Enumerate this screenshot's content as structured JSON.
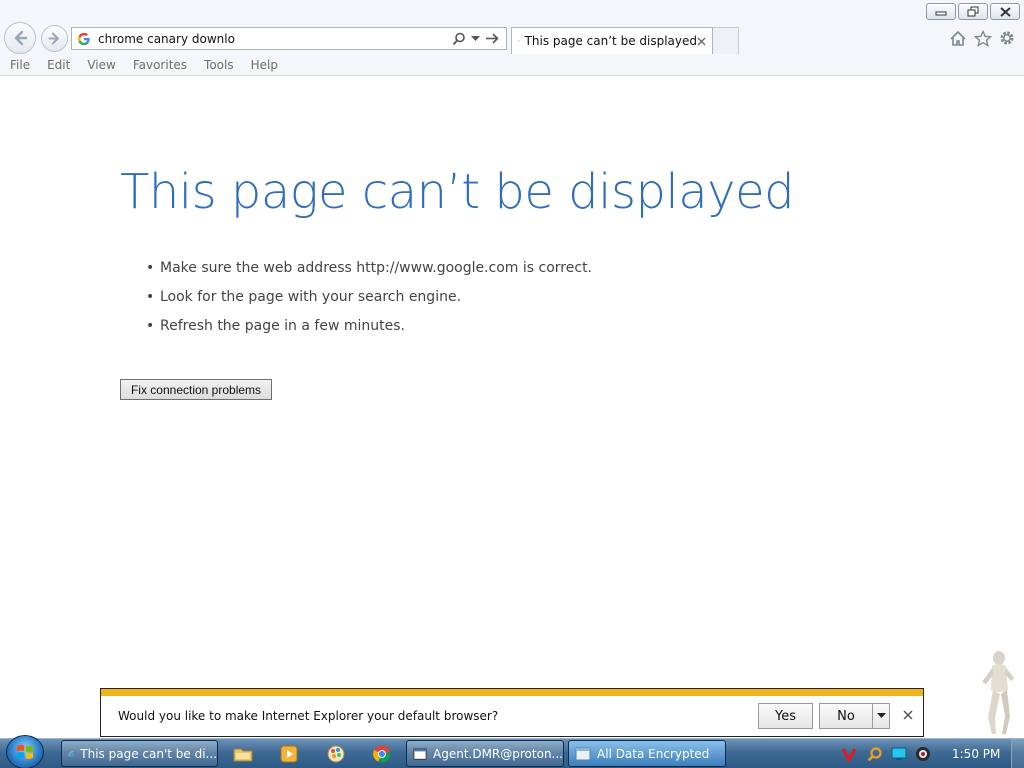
{
  "browser": {
    "address": {
      "text": "chrome canary downlo",
      "icon": "google-g-icon"
    },
    "tab": {
      "title": "This page can’t be displayed",
      "icon": "google-g-icon"
    },
    "window_controls": [
      "minimize",
      "restore",
      "close"
    ],
    "toolbar_icons": [
      "home-icon",
      "favorites-star-icon",
      "tools-gear-icon"
    ]
  },
  "menu": {
    "items": [
      "File",
      "Edit",
      "View",
      "Favorites",
      "Tools",
      "Help"
    ]
  },
  "error_page": {
    "title": "This page can’t be displayed",
    "tips": [
      "Make sure the web address http://www.google.com is correct.",
      "Look for the page with your search engine.",
      "Refresh the page in a few minutes."
    ],
    "fix_button": "Fix connection problems"
  },
  "notification": {
    "message": "Would you like to make Internet Explorer your default browser?",
    "yes": "Yes",
    "no": "No"
  },
  "taskbar": {
    "windows": [
      {
        "label": "This page can't be di...",
        "icon": "ie-icon"
      },
      {
        "label": "Agent.DMR@proton...",
        "icon": "window-icon"
      },
      {
        "label": "All Data Encrypted",
        "icon": "window-icon",
        "active": true
      }
    ],
    "pinned": [
      "explorer-icon",
      "media-player-icon",
      "paint-icon",
      "chrome-icon"
    ],
    "clock": "1:50 PM"
  },
  "colors": {
    "title_blue": "#2f6ebf",
    "notification_stripe": "#f0b41c",
    "taskbar": "#3e6a95"
  }
}
